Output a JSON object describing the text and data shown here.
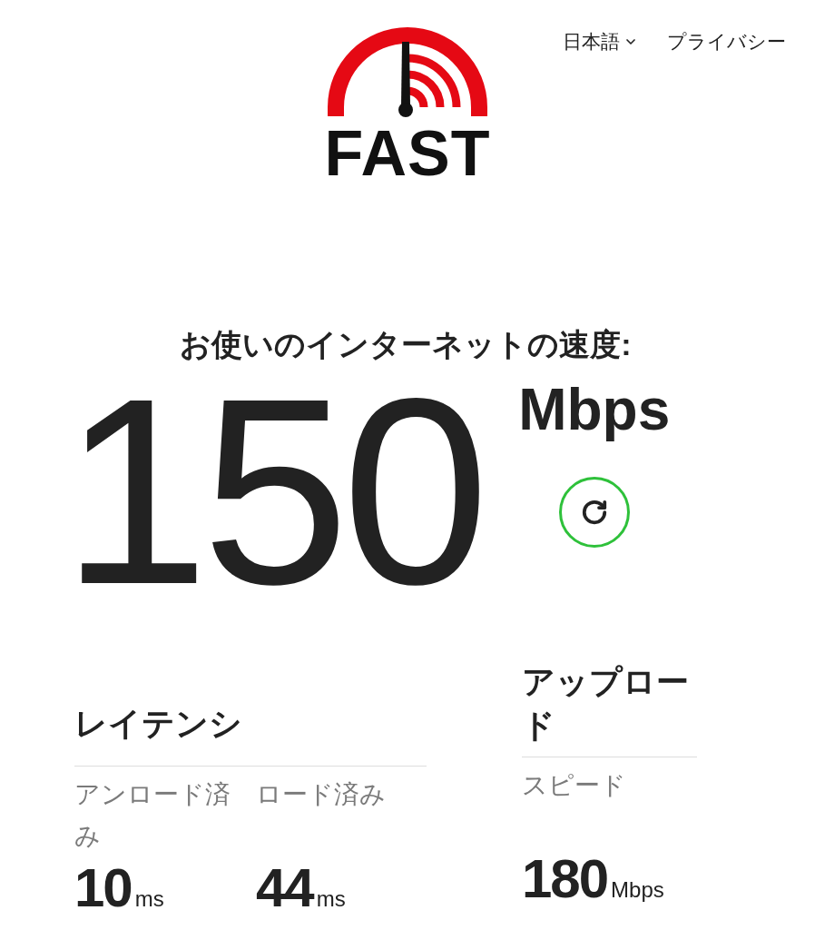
{
  "header": {
    "language": "日本語",
    "privacy": "プライバシー"
  },
  "logo": {
    "text": "FAST"
  },
  "speed": {
    "heading": "お使いのインターネットの速度:",
    "value": "150",
    "unit": "Mbps"
  },
  "latency": {
    "title": "レイテンシ",
    "metrics": [
      {
        "label": "アンロード済み",
        "value": "10",
        "unit": "ms"
      },
      {
        "label": "ロード済み",
        "value": "44",
        "unit": "ms"
      }
    ]
  },
  "upload": {
    "title": "アップロード",
    "metrics": [
      {
        "label": "スピード",
        "value": "180",
        "unit": "Mbps"
      }
    ]
  }
}
